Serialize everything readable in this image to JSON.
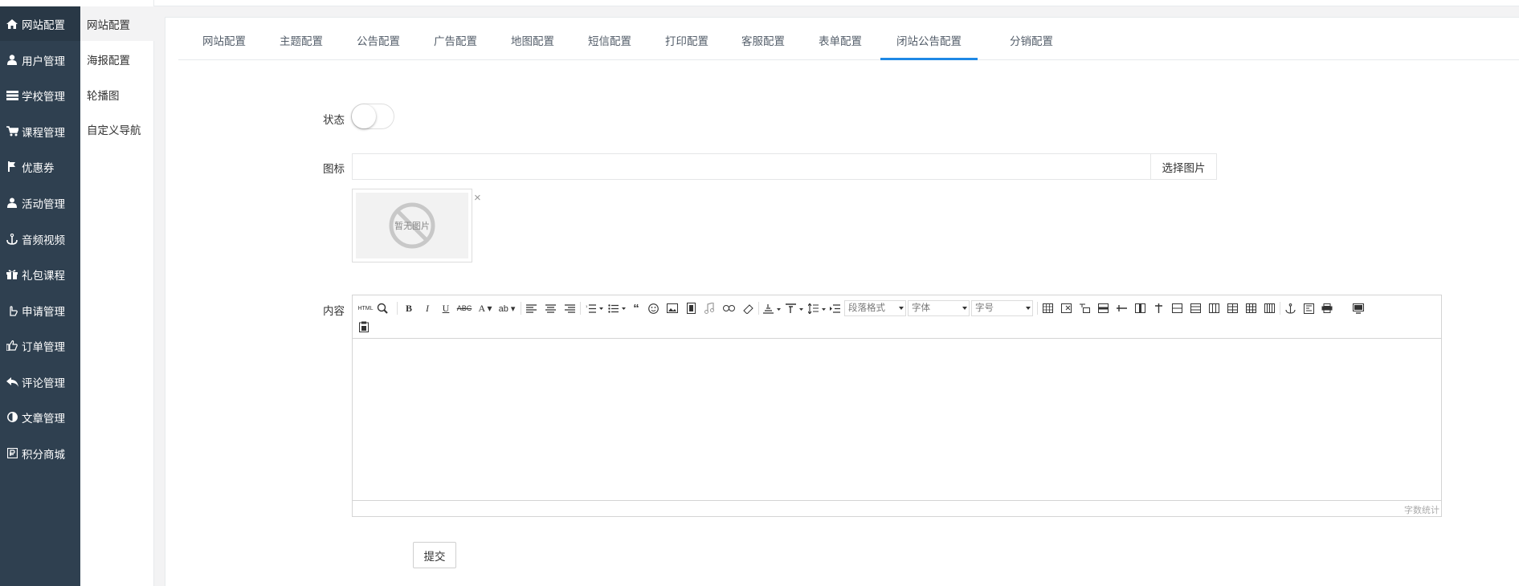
{
  "sidebar": {
    "items": [
      {
        "label": "网站配置",
        "icon": "home-icon"
      },
      {
        "label": "用户管理",
        "icon": "user-icon"
      },
      {
        "label": "学校管理",
        "icon": "list-icon"
      },
      {
        "label": "课程管理",
        "icon": "cart-icon"
      },
      {
        "label": "优惠券",
        "icon": "flag-icon"
      },
      {
        "label": "活动管理",
        "icon": "users-icon"
      },
      {
        "label": "音频视频",
        "icon": "anchor-icon"
      },
      {
        "label": "礼包课程",
        "icon": "gift-icon"
      },
      {
        "label": "申请管理",
        "icon": "hand-icon"
      },
      {
        "label": "订单管理",
        "icon": "thumb-icon"
      },
      {
        "label": "评论管理",
        "icon": "reply-icon"
      },
      {
        "label": "文章管理",
        "icon": "contrast-icon"
      },
      {
        "label": "积分商城",
        "icon": "ruble-icon"
      }
    ]
  },
  "submenu": {
    "items": [
      "网站配置",
      "海报配置",
      "轮播图",
      "自定义导航"
    ]
  },
  "tabs": [
    "网站配置",
    "主题配置",
    "公告配置",
    "广告配置",
    "地图配置",
    "短信配置",
    "打印配置",
    "客服配置",
    "表单配置",
    "闭站公告配置",
    "分销配置"
  ],
  "active_tab": "闭站公告配置",
  "form": {
    "status_label": "状态",
    "status_on": false,
    "icon_label": "图标",
    "icon_value": "",
    "choose_image_label": "选择图片",
    "no_image_text": "暂无图片",
    "delete_symbol": "×",
    "content_label": "内容",
    "paragraph_format": "段落格式",
    "font_family": "字体",
    "font_size": "字号",
    "word_count_label": "字数统计",
    "submit_label": "提交"
  },
  "colors": {
    "sidebar_bg": "#2f4050",
    "sidebar_active": "#293846",
    "tab_active_underline": "#1e88e5"
  }
}
